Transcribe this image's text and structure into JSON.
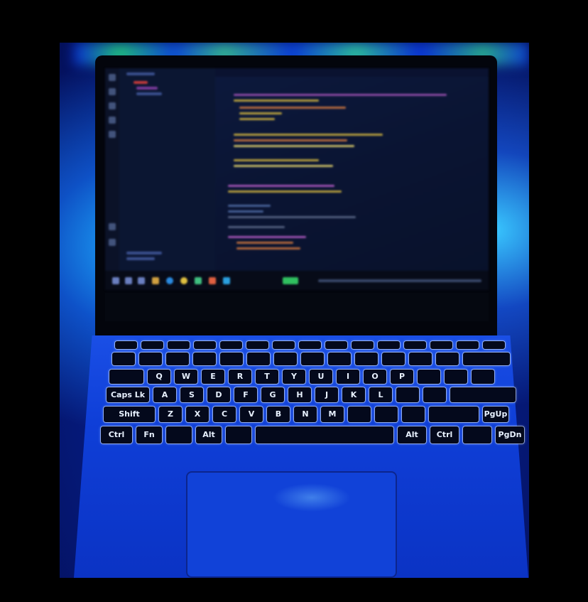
{
  "scene": {
    "description_label": "Laptop with backlit keyboard showing code editor",
    "colors": {
      "ambient": "#0b2fb8",
      "led_green": "#2bff8a",
      "screen_bg": "#0a1432",
      "key_glow": "#e8f1ff"
    }
  },
  "keyboard": {
    "row1": [
      "Q",
      "W",
      "E",
      "R",
      "T",
      "Y",
      "U",
      "I",
      "O",
      "P"
    ],
    "row2": [
      "A",
      "S",
      "D",
      "F",
      "G",
      "H",
      "J",
      "K",
      "L"
    ],
    "row3": [
      "Z",
      "X",
      "C",
      "V",
      "B",
      "N",
      "M"
    ],
    "mods": {
      "caps": "Caps Lk",
      "shift": "Shift",
      "ctrl": "Ctrl",
      "fn": "Fn",
      "alt": "Alt",
      "alt_r": "Alt",
      "ctrl_r": "Ctrl",
      "pgup": "PgUp",
      "pgdn": "PgDn"
    }
  }
}
